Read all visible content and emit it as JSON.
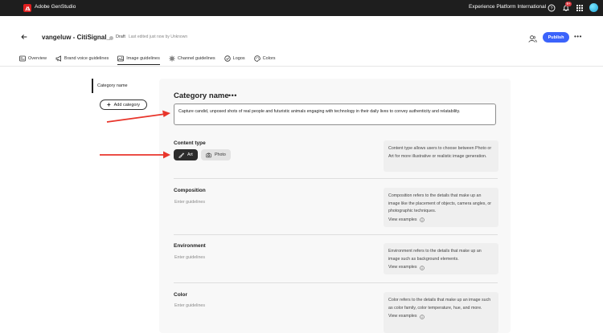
{
  "topbar": {
    "app_title": "Adobe GenStudio",
    "org_name": "Experience Platform International",
    "notification_count": "9+"
  },
  "header": {
    "title": "vangeluw - CitiSignal_",
    "status": "Draft",
    "edited": "Last edited just now by Unknown",
    "publish_label": "Publish"
  },
  "tabs": [
    {
      "label": "Overview",
      "icon": "overview-icon",
      "active": false
    },
    {
      "label": "Brand voice guidelines",
      "icon": "megaphone-icon",
      "active": false
    },
    {
      "label": "Image guidelines",
      "icon": "image-icon",
      "active": true
    },
    {
      "label": "Channel guidelines",
      "icon": "channel-icon",
      "active": false
    },
    {
      "label": "Logos",
      "icon": "logo-icon",
      "active": false
    },
    {
      "label": "Colors",
      "icon": "palette-icon",
      "active": false
    }
  ],
  "sidebar": {
    "category_label": "Category name",
    "add_label": "Add category"
  },
  "main": {
    "category_title": "Category name",
    "description": "Capture candid, unposed shots of real people and futuristic animals engaging with technology in their daily lives to convey authenticity and relatability.",
    "content_type": {
      "title": "Content type",
      "art_label": "Art",
      "photo_label": "Photo",
      "info": "Content type allows users to choose between Photo or Art for more illustrative or realistic image generation."
    },
    "composition": {
      "title": "Composition",
      "placeholder": "Enter guidelines",
      "info": "Composition refers to the details that make up an image like the placement of objects, camera angles, or photographic techniques.",
      "link": "View examples"
    },
    "environment": {
      "title": "Environment",
      "placeholder": "Enter guidelines",
      "info": "Environment refers to the details that make up an image such as background elements.",
      "link": "View examples"
    },
    "color": {
      "title": "Color",
      "placeholder": "Enter guidelines",
      "info": "Color refers to the details that make up an image such as color family, color temperature, hue, and more.",
      "link": "View examples"
    }
  },
  "colors": {
    "accent": "#3b63fb",
    "annotation_arrow": "#e8352b",
    "brand": "#e01f1f"
  }
}
